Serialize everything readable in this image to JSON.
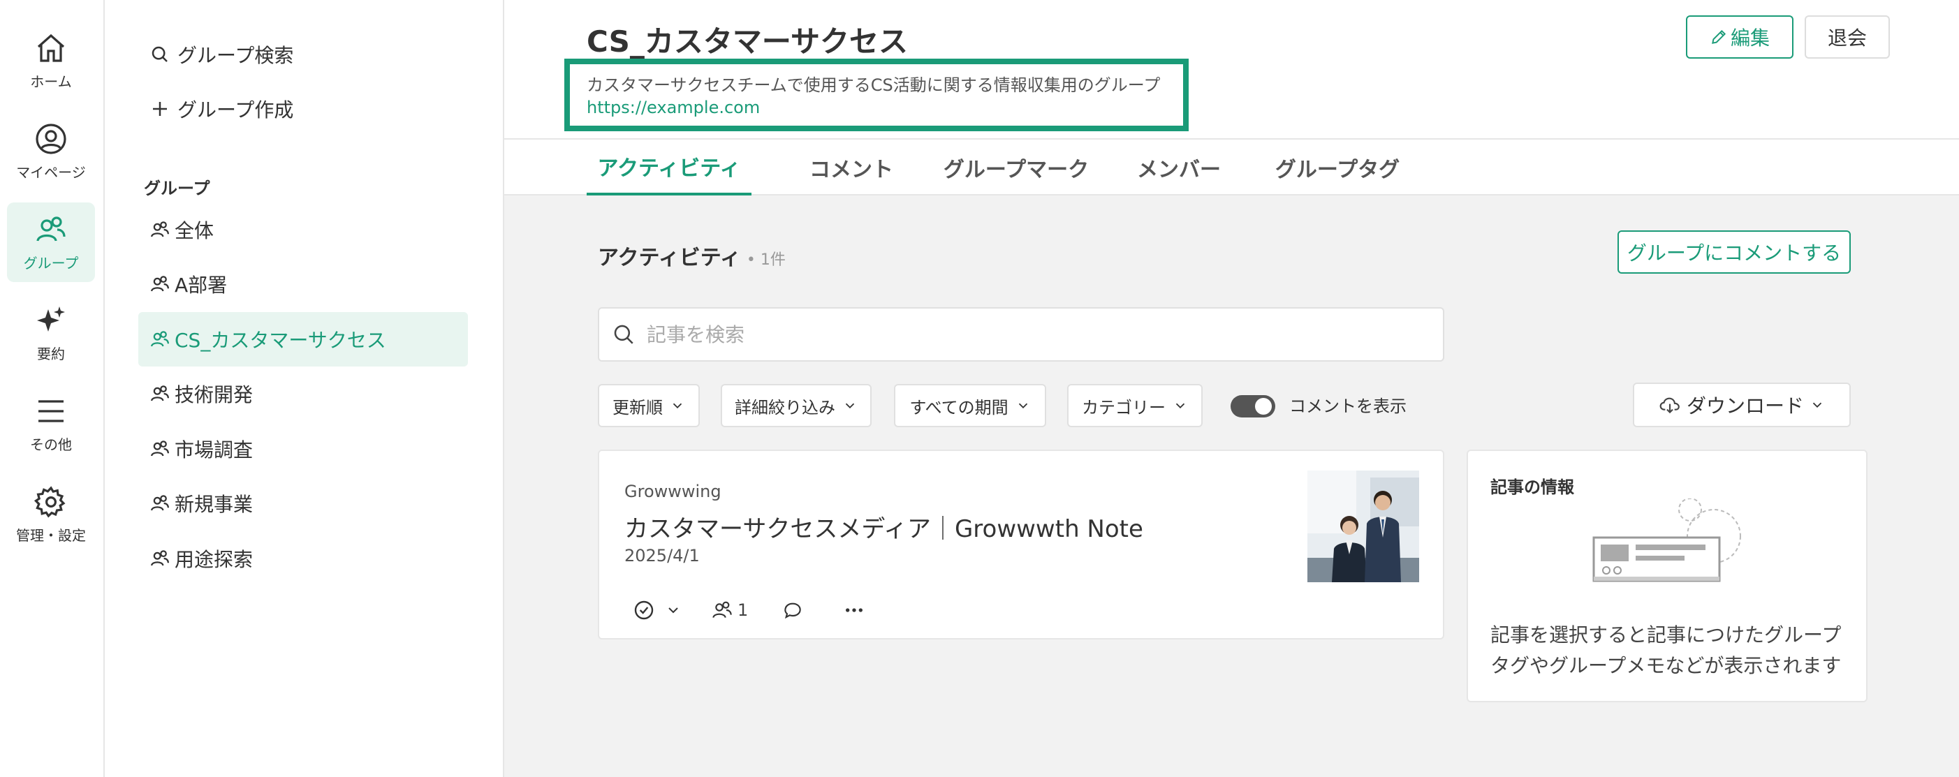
{
  "rail": {
    "items": [
      {
        "label": "ホーム",
        "icon": "home-icon"
      },
      {
        "label": "マイページ",
        "icon": "user-circle-icon"
      },
      {
        "label": "グループ",
        "icon": "group-icon"
      },
      {
        "label": "要約",
        "icon": "sparkle-icon"
      },
      {
        "label": "その他",
        "icon": "menu-icon"
      },
      {
        "label": "管理・設定",
        "icon": "gear-icon"
      }
    ],
    "active": "グループ"
  },
  "sidebar": {
    "search_label": "グループ検索",
    "create_label": "グループ作成",
    "groups_heading": "グループ",
    "groups": [
      "全体",
      "A部署",
      "CS_カスタマーサクセス",
      "技術開発",
      "市場調査",
      "新規事業",
      "用途探索"
    ],
    "active_group": "CS_カスタマーサクセス"
  },
  "header": {
    "title": "CS_カスタマーサクセス",
    "description": "カスタマーサクセスチームで使用するCS活動に関する情報収集用のグループ",
    "link": "https://example.com",
    "edit_label": "編集",
    "leave_label": "退会"
  },
  "tabs": [
    "アクティビティ",
    "コメント",
    "グループマーク",
    "メンバー",
    "グループタグ"
  ],
  "active_tab": "アクティビティ",
  "activity": {
    "title": "アクティビティ",
    "count": "• 1件",
    "comment_button": "グループにコメントする",
    "search_placeholder": "記事を検索",
    "filters": [
      "更新順",
      "詳細絞り込み",
      "すべての期間",
      "カテゴリー"
    ],
    "toggle_label": "コメントを表示",
    "toggle_on": true,
    "download_label": "ダウンロード"
  },
  "articles": [
    {
      "source": "Growwwing",
      "title": "カスタマーサクセスメディア｜Growwwth Note",
      "date": "2025/4/1",
      "member_count": "1"
    }
  ],
  "info_panel": {
    "title": "記事の情報",
    "text": "記事を選択すると記事につけたグループタグやグループメモなどが表示されます"
  },
  "colors": {
    "accent": "#1a9b78",
    "accent_light": "#e8f5f0",
    "background": "#f2f2f2"
  }
}
